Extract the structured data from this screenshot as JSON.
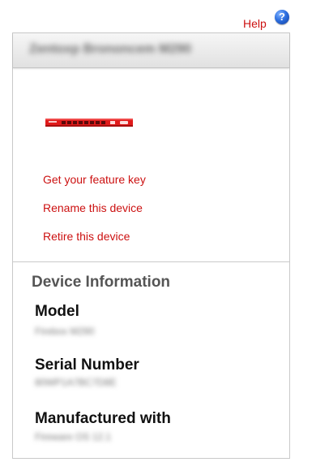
{
  "help": {
    "label": "Help",
    "icon": "help-question-icon",
    "icon_glyph": "?"
  },
  "device": {
    "name": "Zentoxp Brononcem M290",
    "image_icon": "firewall-appliance-icon",
    "brand_color": "#e01b1b"
  },
  "actions": [
    {
      "label": "Get your feature key"
    },
    {
      "label": "Rename this device"
    },
    {
      "label": "Retire this device"
    }
  ],
  "device_information": {
    "title": "Device Information",
    "fields": [
      {
        "label": "Model",
        "value": "Firebox M290"
      },
      {
        "label": "Serial Number",
        "value": "80WP1A7BC7D8E"
      },
      {
        "label": "Manufactured with",
        "value": "Fireware OS 12.1"
      }
    ]
  },
  "colors": {
    "link": "#cc1111",
    "panel_border": "#c9c9c9",
    "heading": "#555555"
  }
}
